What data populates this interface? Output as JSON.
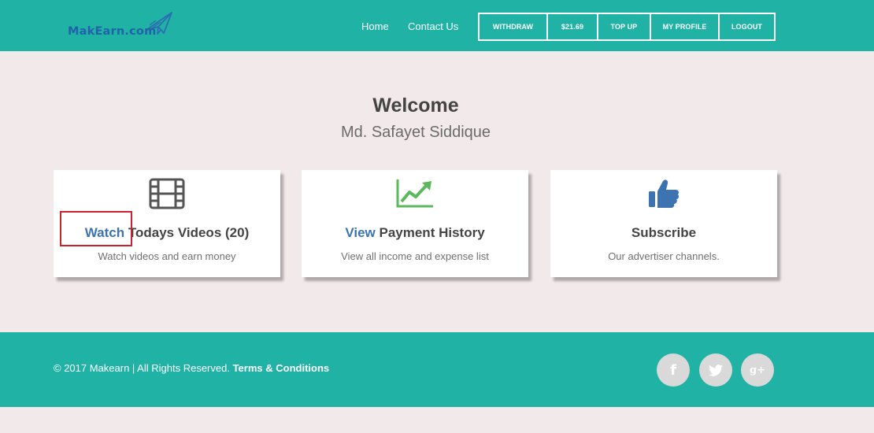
{
  "header": {
    "logo_text": "MakEarn.com",
    "nav": {
      "home": "Home",
      "contact": "Contact Us"
    },
    "buttons": {
      "withdraw": "WITHDRAW",
      "balance": "$21.69",
      "topup": "TOP UP",
      "profile": "MY PROFILE",
      "logout": "LOGOUT"
    }
  },
  "welcome": {
    "title": "Welcome",
    "name": "Md. Safayet Siddique"
  },
  "cards": [
    {
      "icon": "film-icon",
      "accent": "Watch",
      "title": " Todays Videos (20)",
      "desc": "Watch videos and earn money"
    },
    {
      "icon": "line-chart-icon",
      "accent": "View",
      "title": " Payment History",
      "desc": "View all income and expense list"
    },
    {
      "icon": "thumbs-up-icon",
      "accent": "",
      "title": "Subscribe",
      "desc": "Our advertiser channels."
    }
  ],
  "footer": {
    "copyright": "© 2017 Makearn | All Rights Reserved. ",
    "terms": "Terms & Conditions",
    "social": {
      "facebook": "f",
      "google_plus": "g+"
    }
  },
  "colors": {
    "teal": "#20b2a5",
    "page_bg": "#f2e9ea",
    "accent_blue": "#3e73b1",
    "highlight_red": "#d0202a",
    "chart_green": "#5cb85c"
  }
}
